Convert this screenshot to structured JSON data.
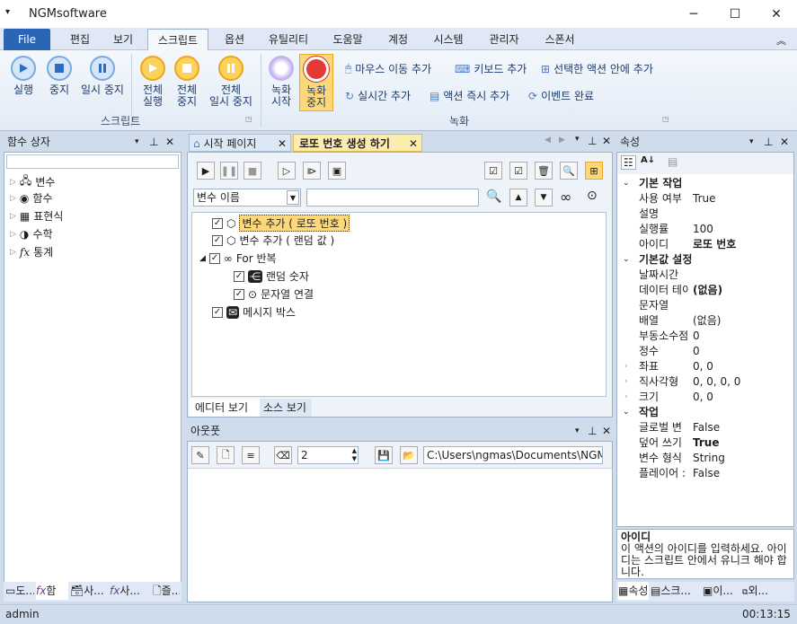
{
  "app": {
    "title": "NGMsoftware",
    "minimize": "─",
    "maximize": "☐",
    "close": "✕"
  },
  "menu": {
    "file": "File",
    "tabs": [
      "편집",
      "보기",
      "스크립트",
      "옵션",
      "유틸리티",
      "도움말",
      "계정",
      "시스템",
      "관리자",
      "스폰서"
    ]
  },
  "ribbon": {
    "run": "실행",
    "stop": "중지",
    "pause": "일시 중지",
    "run_all_1": "전체",
    "run_all_2": "실행",
    "stop_all_1": "전체",
    "stop_all_2": "중지",
    "pause_all_1": "전체",
    "pause_all_2": "일시 중지",
    "group_script": "스크립트",
    "rec_start_1": "녹화",
    "rec_start_2": "시작",
    "rec_stop_1": "녹화",
    "rec_stop_2": "중지",
    "mouse_move": "마우스 이동 추가",
    "keyboard": "키보드 추가",
    "add_in_selected": "선택한 액션 안에 추가",
    "realtime": "실시간 추가",
    "action_now": "액션 즉시 추가",
    "event_done": "이벤트 완료",
    "group_record": "녹화"
  },
  "left_panel": {
    "title": "함수 상자",
    "items": [
      "변수",
      "함수",
      "표현식",
      "수학",
      "통계"
    ],
    "bottom_tabs": [
      "도...",
      "함",
      "사...",
      "사...",
      "즐..."
    ]
  },
  "editor": {
    "tab_start": "시작 페이지",
    "tab_lotto": "로또 번호 생성 하기",
    "filter_select": "변수 이름",
    "filter_value": "",
    "tree": [
      "변수 추가 ( 로또 번호 )",
      "변수 추가 ( 랜덤 값 )",
      "For 반복",
      "랜덤 숫자",
      "문자열 연결",
      "메시지 박스"
    ],
    "view_editor": "에디터 보기",
    "view_source": "소스 보기"
  },
  "output": {
    "title": "아웃풋",
    "count": "2",
    "path": "C:\\Users\\ngmas\\Documents\\NGM6\\"
  },
  "props": {
    "title": "속성",
    "rows": [
      {
        "t": "cat",
        "n": "기본 작업"
      },
      {
        "t": "row",
        "n": "사용 여부",
        "v": "True"
      },
      {
        "t": "row",
        "n": "설명",
        "v": ""
      },
      {
        "t": "row",
        "n": "실행률",
        "v": "100"
      },
      {
        "t": "row",
        "n": "아이디",
        "v": "로또 번호",
        "b": true
      },
      {
        "t": "cat",
        "n": "기본값 설정"
      },
      {
        "t": "row",
        "n": "날짜시간",
        "v": ""
      },
      {
        "t": "row",
        "n": "데이터 테이",
        "v": "(없음)",
        "b": true
      },
      {
        "t": "row",
        "n": "문자열",
        "v": ""
      },
      {
        "t": "row",
        "n": "배열",
        "v": "(없음)"
      },
      {
        "t": "row",
        "n": "부동소수점",
        "v": "0"
      },
      {
        "t": "row",
        "n": "정수",
        "v": "0"
      },
      {
        "t": "row",
        "n": "좌표",
        "v": "0, 0",
        "e": true
      },
      {
        "t": "row",
        "n": "직사각형",
        "v": "0, 0, 0, 0",
        "e": true
      },
      {
        "t": "row",
        "n": "크기",
        "v": "0, 0",
        "e": true
      },
      {
        "t": "cat",
        "n": "작업"
      },
      {
        "t": "row",
        "n": "글로벌 변",
        "v": "False"
      },
      {
        "t": "row",
        "n": "덮어 쓰기",
        "v": "True",
        "b": true
      },
      {
        "t": "row",
        "n": "변수 형식",
        "v": "String"
      },
      {
        "t": "row",
        "n": "플레이어 :",
        "v": "False"
      }
    ],
    "desc_title": "아이디",
    "desc_text": "이 액션의 아이디를 입력하세요. 아이디는 스크립트 안에서 유니크 해야 합니다.",
    "bottom_tabs": [
      "속성",
      "스크...",
      "이...",
      "외..."
    ]
  },
  "status": {
    "user": "admin",
    "time": "00:13:15"
  }
}
